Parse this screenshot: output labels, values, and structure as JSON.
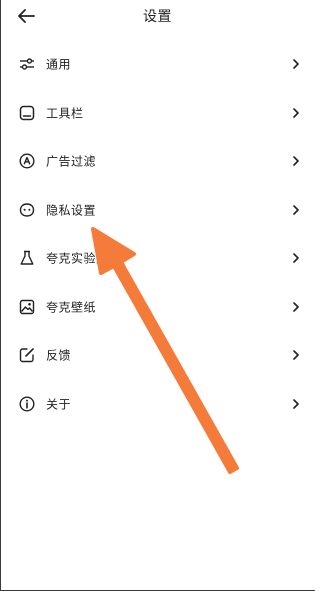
{
  "header": {
    "title": "设置",
    "back_icon": "arrow-left-icon"
  },
  "menu": {
    "items": [
      {
        "label": "通用",
        "icon": "sliders-icon"
      },
      {
        "label": "工具栏",
        "icon": "toolbar-icon"
      },
      {
        "label": "广告过滤",
        "icon": "ad-block-icon"
      },
      {
        "label": "隐私设置",
        "icon": "privacy-mask-icon"
      },
      {
        "label": "夸克实验室",
        "icon": "flask-icon"
      },
      {
        "label": "夸克壁纸",
        "icon": "wallpaper-icon"
      },
      {
        "label": "反馈",
        "icon": "feedback-edit-icon"
      },
      {
        "label": "关于",
        "icon": "info-icon"
      }
    ],
    "chevron_icon": "chevron-right-icon"
  },
  "annotation": {
    "icon": "pointer-arrow-icon",
    "color": "#F47B3A"
  }
}
